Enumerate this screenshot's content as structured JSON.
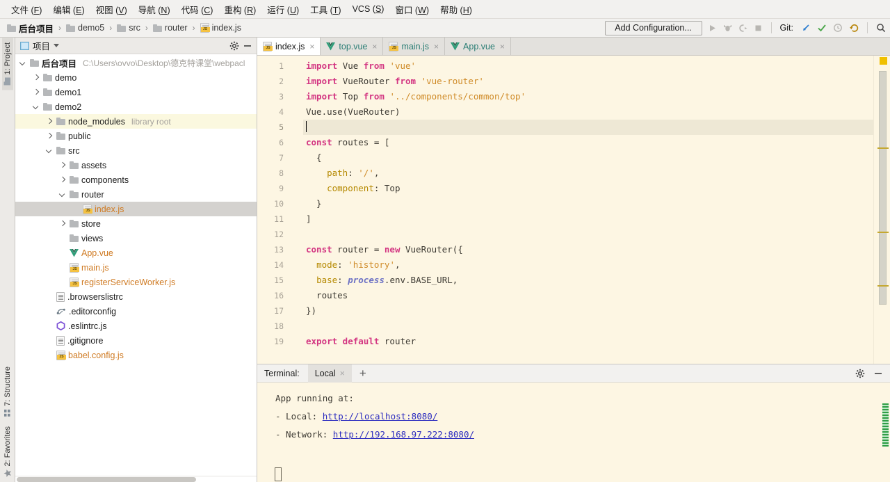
{
  "menubar": {
    "items": [
      {
        "label": "文件",
        "mnemonic": "F"
      },
      {
        "label": "编辑",
        "mnemonic": "E"
      },
      {
        "label": "视图",
        "mnemonic": "V"
      },
      {
        "label": "导航",
        "mnemonic": "N"
      },
      {
        "label": "代码",
        "mnemonic": "C"
      },
      {
        "label": "重构",
        "mnemonic": "R"
      },
      {
        "label": "运行",
        "mnemonic": "U"
      },
      {
        "label": "工具",
        "mnemonic": "T"
      },
      {
        "label": "VCS",
        "mnemonic": "S"
      },
      {
        "label": "窗口",
        "mnemonic": "W"
      },
      {
        "label": "帮助",
        "mnemonic": "H"
      }
    ]
  },
  "toolbar": {
    "breadcrumbs": [
      {
        "label": "后台项目",
        "icon": "folder-icon"
      },
      {
        "label": "demo5",
        "icon": "folder-icon"
      },
      {
        "label": "src",
        "icon": "folder-icon"
      },
      {
        "label": "router",
        "icon": "folder-icon"
      },
      {
        "label": "index.js",
        "icon": "js-file-icon"
      }
    ],
    "separator": "›",
    "add_configuration": "Add Configuration...",
    "git_label": "Git:",
    "icons": [
      "run-icon",
      "debug-icon",
      "run-with-coverage-icon",
      "stop-icon",
      "git-update-icon",
      "git-commit-icon",
      "git-history-icon",
      "git-rollback-icon",
      "search-everywhere-icon"
    ]
  },
  "rail": {
    "top": [
      {
        "label": "1: Project",
        "icon": "project-icon",
        "active": true
      }
    ],
    "bottom": [
      {
        "label": "7: Structure",
        "icon": "structure-icon",
        "active": false
      },
      {
        "label": "2: Favorites",
        "icon": "star-icon",
        "active": false
      }
    ]
  },
  "project_panel": {
    "title": "项目",
    "caret_icon": "chevron-down-icon",
    "gear_icon": "gear-icon",
    "minimize_icon": "minimize-icon",
    "tree": [
      {
        "indent": 0,
        "arrow": "down",
        "icon": "folder-icon",
        "label": "后台项目",
        "bold": true,
        "sub": "C:\\Users\\ovvo\\Desktop\\德克特课堂\\webpacl",
        "state": "normal"
      },
      {
        "indent": 1,
        "arrow": "right",
        "icon": "folder-icon",
        "label": "demo",
        "state": "normal"
      },
      {
        "indent": 1,
        "arrow": "right",
        "icon": "folder-icon",
        "label": "demo1",
        "state": "normal"
      },
      {
        "indent": 1,
        "arrow": "down",
        "icon": "folder-icon",
        "label": "demo2",
        "state": "normal"
      },
      {
        "indent": 2,
        "arrow": "right",
        "icon": "folder-icon",
        "label": "node_modules",
        "sub": "library root",
        "state": "highlight"
      },
      {
        "indent": 2,
        "arrow": "right",
        "icon": "folder-icon",
        "label": "public",
        "state": "normal"
      },
      {
        "indent": 2,
        "arrow": "down",
        "icon": "folder-icon",
        "label": "src",
        "state": "normal"
      },
      {
        "indent": 3,
        "arrow": "right",
        "icon": "folder-icon",
        "label": "assets",
        "state": "normal"
      },
      {
        "indent": 3,
        "arrow": "right",
        "icon": "folder-icon",
        "label": "components",
        "state": "normal"
      },
      {
        "indent": 3,
        "arrow": "down",
        "icon": "folder-icon",
        "label": "router",
        "state": "normal"
      },
      {
        "indent": 4,
        "arrow": "none",
        "icon": "js-file-icon",
        "label": "index.js",
        "orange": true,
        "state": "selected"
      },
      {
        "indent": 3,
        "arrow": "right",
        "icon": "folder-icon",
        "label": "store",
        "state": "normal"
      },
      {
        "indent": 3,
        "arrow": "none",
        "icon": "folder-icon",
        "label": "views",
        "state": "normal"
      },
      {
        "indent": 3,
        "arrow": "none",
        "icon": "vue-file-icon",
        "label": "App.vue",
        "orange": true,
        "state": "normal"
      },
      {
        "indent": 3,
        "arrow": "none",
        "icon": "js-file-icon",
        "label": "main.js",
        "orange": true,
        "state": "normal"
      },
      {
        "indent": 3,
        "arrow": "none",
        "icon": "js-file-icon",
        "label": "registerServiceWorker.js",
        "orange": true,
        "state": "normal"
      },
      {
        "indent": 2,
        "arrow": "none",
        "icon": "text-file-icon",
        "label": ".browserslistrc",
        "state": "normal"
      },
      {
        "indent": 2,
        "arrow": "none",
        "icon": "editorconfig-icon",
        "label": ".editorconfig",
        "state": "normal"
      },
      {
        "indent": 2,
        "arrow": "none",
        "icon": "eslint-icon",
        "label": ".eslintrc.js",
        "state": "normal"
      },
      {
        "indent": 2,
        "arrow": "none",
        "icon": "text-file-icon",
        "label": ".gitignore",
        "state": "normal"
      },
      {
        "indent": 2,
        "arrow": "none",
        "icon": "js-file-icon",
        "label": "babel.config.js",
        "orange": true,
        "state": "normal"
      }
    ]
  },
  "editor": {
    "tabs": [
      {
        "label": "index.js",
        "icon": "js-file-icon",
        "active": true,
        "close": "×"
      },
      {
        "label": "top.vue",
        "icon": "vue-file-icon",
        "active": false,
        "close": "×"
      },
      {
        "label": "main.js",
        "icon": "js-file-icon",
        "active": false,
        "close": "×"
      },
      {
        "label": "App.vue",
        "icon": "vue-file-icon",
        "active": false,
        "close": "×"
      }
    ],
    "current_line": 5,
    "lines": [
      {
        "n": 1,
        "tokens": [
          {
            "t": "import ",
            "c": "kw"
          },
          {
            "t": "Vue ",
            "c": "plain"
          },
          {
            "t": "from ",
            "c": "kw"
          },
          {
            "t": "'vue'",
            "c": "str"
          }
        ]
      },
      {
        "n": 2,
        "tokens": [
          {
            "t": "import ",
            "c": "kw"
          },
          {
            "t": "VueRouter ",
            "c": "plain"
          },
          {
            "t": "from ",
            "c": "kw"
          },
          {
            "t": "'vue-router'",
            "c": "str"
          }
        ]
      },
      {
        "n": 3,
        "tokens": [
          {
            "t": "import ",
            "c": "kw"
          },
          {
            "t": "Top ",
            "c": "plain"
          },
          {
            "t": "from ",
            "c": "kw"
          },
          {
            "t": "'../components/common/top'",
            "c": "str"
          }
        ]
      },
      {
        "n": 4,
        "tokens": [
          {
            "t": "Vue.use(VueRouter)",
            "c": "plain"
          }
        ]
      },
      {
        "n": 5,
        "tokens": []
      },
      {
        "n": 6,
        "tokens": [
          {
            "t": "const ",
            "c": "kw"
          },
          {
            "t": "routes = [",
            "c": "plain"
          }
        ]
      },
      {
        "n": 7,
        "tokens": [
          {
            "t": "  {",
            "c": "plain"
          }
        ]
      },
      {
        "n": 8,
        "tokens": [
          {
            "t": "    ",
            "c": "plain"
          },
          {
            "t": "path",
            "c": "prop"
          },
          {
            "t": ": ",
            "c": "plain"
          },
          {
            "t": "'/'",
            "c": "str"
          },
          {
            "t": ",",
            "c": "plain"
          }
        ]
      },
      {
        "n": 9,
        "tokens": [
          {
            "t": "    ",
            "c": "plain"
          },
          {
            "t": "component",
            "c": "prop"
          },
          {
            "t": ": Top",
            "c": "plain"
          }
        ]
      },
      {
        "n": 10,
        "tokens": [
          {
            "t": "  }",
            "c": "plain"
          }
        ]
      },
      {
        "n": 11,
        "tokens": [
          {
            "t": "]",
            "c": "plain"
          }
        ]
      },
      {
        "n": 12,
        "tokens": []
      },
      {
        "n": 13,
        "tokens": [
          {
            "t": "const ",
            "c": "kw"
          },
          {
            "t": "router = ",
            "c": "plain"
          },
          {
            "t": "new ",
            "c": "kw"
          },
          {
            "t": "VueRouter({",
            "c": "plain"
          }
        ]
      },
      {
        "n": 14,
        "tokens": [
          {
            "t": "  ",
            "c": "plain"
          },
          {
            "t": "mode",
            "c": "prop"
          },
          {
            "t": ": ",
            "c": "plain"
          },
          {
            "t": "'history'",
            "c": "str"
          },
          {
            "t": ",",
            "c": "plain"
          }
        ]
      },
      {
        "n": 15,
        "tokens": [
          {
            "t": "  ",
            "c": "plain"
          },
          {
            "t": "base",
            "c": "prop"
          },
          {
            "t": ": ",
            "c": "plain"
          },
          {
            "t": "process",
            "c": "proc"
          },
          {
            "t": ".env.BASE_URL,",
            "c": "plain"
          }
        ]
      },
      {
        "n": 16,
        "tokens": [
          {
            "t": "  routes",
            "c": "plain"
          }
        ]
      },
      {
        "n": 17,
        "tokens": [
          {
            "t": "})",
            "c": "plain"
          }
        ]
      },
      {
        "n": 18,
        "tokens": []
      },
      {
        "n": 19,
        "tokens": [
          {
            "t": "export default ",
            "c": "kw"
          },
          {
            "t": "router",
            "c": "plain"
          }
        ]
      }
    ]
  },
  "terminal": {
    "label": "Terminal:",
    "tab": "Local",
    "tab_close": "×",
    "new_tab": "+",
    "gear_icon": "gear-icon",
    "minimize_icon": "minimize-icon",
    "output": [
      {
        "text": "App running at:",
        "link": null
      },
      {
        "text": "  - Local:   ",
        "link": "http://localhost:8080/"
      },
      {
        "text": "  - Network: ",
        "link": "http://192.168.97.222:8080/"
      }
    ]
  },
  "colors": {
    "editor_bg": "#fdf6e3",
    "keyword": "#d33682",
    "string": "#cf8b28",
    "property": "#b58900",
    "process": "#6c71c4",
    "link": "#2b2bbf",
    "tab_text": "#2a7d74",
    "selection": "#d4d2cf",
    "highlight": "#fbf8df",
    "marker": "#f0c000"
  }
}
